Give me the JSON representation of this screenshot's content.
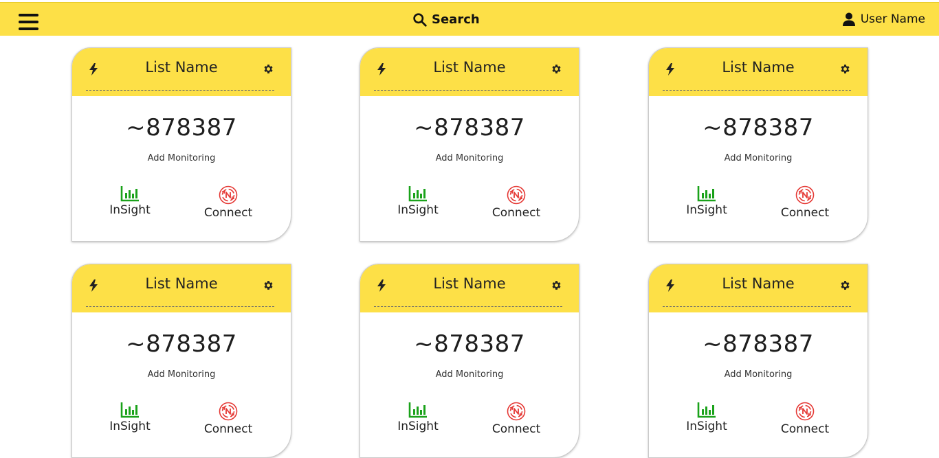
{
  "header": {
    "search_label": "Search",
    "user_label": "User Name",
    "accent": "#fde047"
  },
  "cards": [
    {
      "title": "List Name",
      "value": "~878387",
      "subtitle": "Add Monitoring",
      "insight_label": "InSight",
      "connect_label": "Connect"
    },
    {
      "title": "List Name",
      "value": "~878387",
      "subtitle": "Add Monitoring",
      "insight_label": "InSight",
      "connect_label": "Connect"
    },
    {
      "title": "List Name",
      "value": "~878387",
      "subtitle": "Add Monitoring",
      "insight_label": "InSight",
      "connect_label": "Connect"
    },
    {
      "title": "List Name",
      "value": "~878387",
      "subtitle": "Add Monitoring",
      "insight_label": "InSight",
      "connect_label": "Connect"
    },
    {
      "title": "List Name",
      "value": "~878387",
      "subtitle": "Add Monitoring",
      "insight_label": "InSight",
      "connect_label": "Connect"
    },
    {
      "title": "List Name",
      "value": "~878387",
      "subtitle": "Add Monitoring",
      "insight_label": "InSight",
      "connect_label": "Connect"
    }
  ],
  "icons": {
    "menu": "hamburger-icon",
    "search": "search-icon",
    "user": "user-icon",
    "bolt": "bolt-icon",
    "settings": "gear-icon",
    "insight": "bar-chart-icon",
    "connect": "connect-icon"
  },
  "colors": {
    "insight": "#1aa21a",
    "connect": "#e53935"
  }
}
